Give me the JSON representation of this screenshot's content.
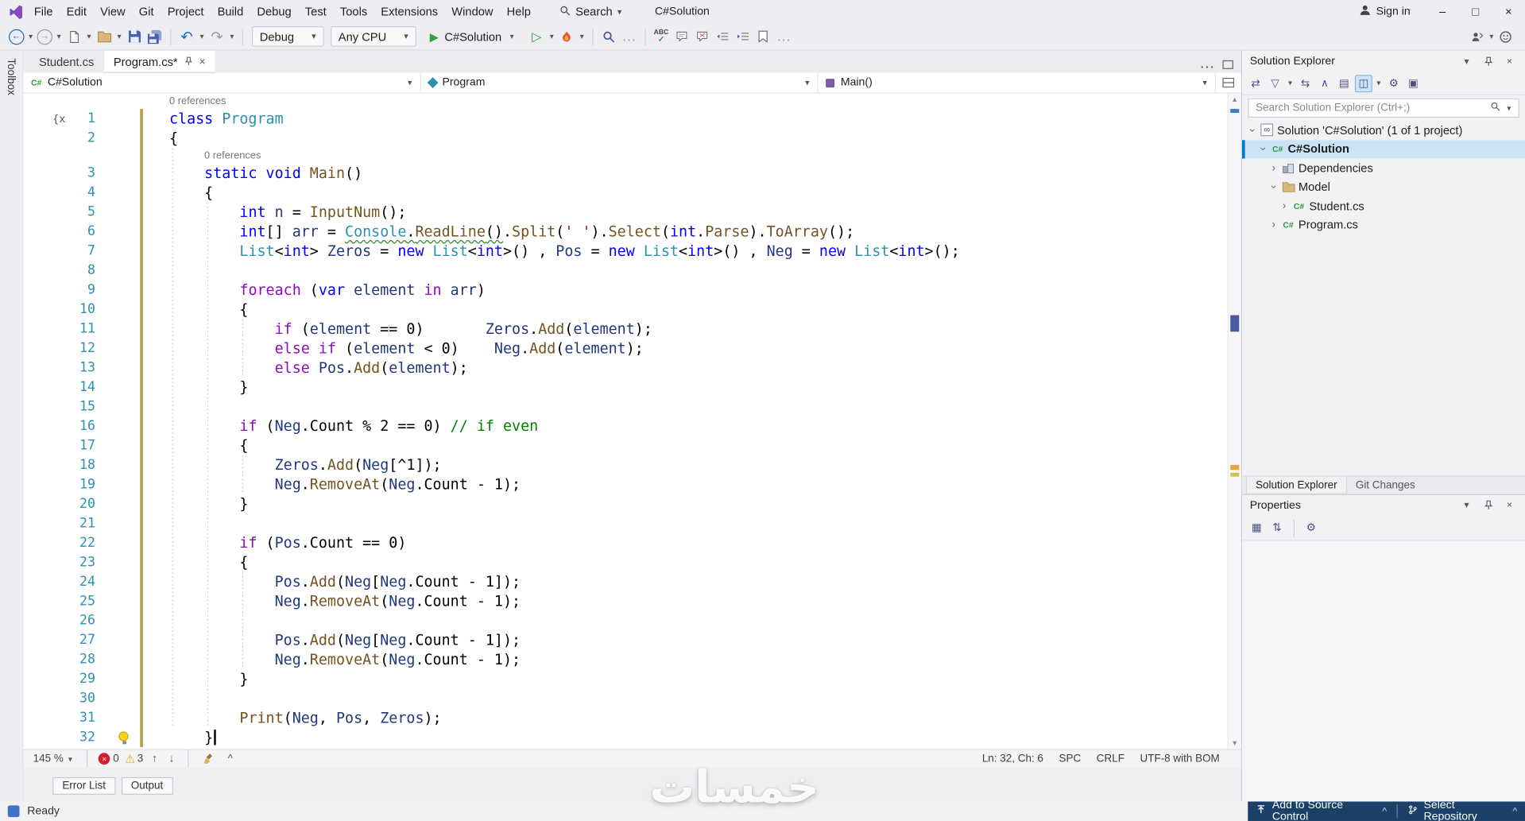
{
  "icons": {
    "back": "←",
    "forward": "→",
    "undo": "↶",
    "redo": "↷",
    "run": "▶",
    "run_outline": "▷",
    "dropdown": "▾",
    "more": "…",
    "close": "×",
    "minimize": "–",
    "maximize": "□",
    "chevron": "›",
    "collapse_all": "∧",
    "switch_views": "⇄",
    "filter": "▽",
    "sync_doc": "⇆",
    "show_all": "▤",
    "nesting": "◫",
    "preview": "▣",
    "categorized": "▦",
    "alphabetical": "⇅",
    "gear": "⚙",
    "warning": "⚠",
    "arrow_up": "↑",
    "arrow_down": "↓",
    "caret_up": "^",
    "triangle_up": "▲",
    "triangle_down": "▼",
    "infinity": "∞",
    "spell": "ABC",
    "check": "✓"
  },
  "titlebar": {
    "menu_items": [
      "File",
      "Edit",
      "View",
      "Git",
      "Project",
      "Build",
      "Debug",
      "Test",
      "Tools",
      "Extensions",
      "Window",
      "Help"
    ],
    "search_label": "Search",
    "solution_title": "C#Solution",
    "sign_in_label": "Sign in"
  },
  "toolbar": {
    "debug_target": "Debug",
    "platform": "Any CPU",
    "run_label": "C#Solution"
  },
  "toolbox_tab": "Toolbox",
  "doc_tabs": [
    {
      "label": "Student.cs",
      "active": false
    },
    {
      "label": "Program.cs*",
      "active": true
    }
  ],
  "navbar": {
    "project": "C#Solution",
    "type_name": "Program",
    "member": "Main()"
  },
  "editor": {
    "rows": [
      {
        "lens": true,
        "indent": 0,
        "text": "0 references"
      },
      {
        "n": 1,
        "glyph": true,
        "segs": [
          [
            "k",
            "class"
          ],
          [
            "p",
            " "
          ],
          [
            "t",
            "Program"
          ]
        ]
      },
      {
        "n": 2,
        "segs": [
          [
            "p",
            "{"
          ]
        ]
      },
      {
        "lens": true,
        "indent": 4,
        "text": "0 references"
      },
      {
        "n": 3,
        "segs": [
          [
            "p",
            "    "
          ],
          [
            "k",
            "static"
          ],
          [
            "p",
            " "
          ],
          [
            "k",
            "void"
          ],
          [
            "p",
            " "
          ],
          [
            "m",
            "Main"
          ],
          [
            "p",
            "()"
          ]
        ]
      },
      {
        "n": 4,
        "segs": [
          [
            "p",
            "    {"
          ]
        ]
      },
      {
        "n": 5,
        "segs": [
          [
            "p",
            "        "
          ],
          [
            "k",
            "int"
          ],
          [
            "p",
            " "
          ],
          [
            "v",
            "n"
          ],
          [
            "p",
            " = "
          ],
          [
            "m",
            "InputNum"
          ],
          [
            "p",
            "();"
          ]
        ]
      },
      {
        "n": 6,
        "segs": [
          [
            "p",
            "        "
          ],
          [
            "k",
            "int"
          ],
          [
            "p",
            "[] "
          ],
          [
            "v",
            "arr"
          ],
          [
            "p",
            " = "
          ],
          [
            "t q",
            "Console"
          ],
          [
            "p q",
            "."
          ],
          [
            "m q",
            "ReadLine"
          ],
          [
            "p q",
            "()"
          ],
          [
            "p",
            "."
          ],
          [
            "m",
            "Split"
          ],
          [
            "p",
            "("
          ],
          [
            "s",
            "' '"
          ],
          [
            "p",
            ")."
          ],
          [
            "m",
            "Select"
          ],
          [
            "p",
            "("
          ],
          [
            "k",
            "int"
          ],
          [
            "p",
            "."
          ],
          [
            "m",
            "Parse"
          ],
          [
            "p",
            ")."
          ],
          [
            "m",
            "ToArray"
          ],
          [
            "p",
            "();"
          ]
        ]
      },
      {
        "n": 7,
        "segs": [
          [
            "p",
            "        "
          ],
          [
            "t",
            "List"
          ],
          [
            "p",
            "<"
          ],
          [
            "k",
            "int"
          ],
          [
            "p",
            "> "
          ],
          [
            "v",
            "Zeros"
          ],
          [
            "p",
            " = "
          ],
          [
            "k",
            "new"
          ],
          [
            "p",
            " "
          ],
          [
            "t",
            "List"
          ],
          [
            "p",
            "<"
          ],
          [
            "k",
            "int"
          ],
          [
            "p",
            ">() , "
          ],
          [
            "v",
            "Pos"
          ],
          [
            "p",
            " = "
          ],
          [
            "k",
            "new"
          ],
          [
            "p",
            " "
          ],
          [
            "t",
            "List"
          ],
          [
            "p",
            "<"
          ],
          [
            "k",
            "int"
          ],
          [
            "p",
            ">() , "
          ],
          [
            "v",
            "Neg"
          ],
          [
            "p",
            " = "
          ],
          [
            "k",
            "new"
          ],
          [
            "p",
            " "
          ],
          [
            "t",
            "List"
          ],
          [
            "p",
            "<"
          ],
          [
            "k",
            "int"
          ],
          [
            "p",
            ">();"
          ]
        ]
      },
      {
        "n": 8,
        "segs": []
      },
      {
        "n": 9,
        "segs": [
          [
            "p",
            "        "
          ],
          [
            "c",
            "foreach"
          ],
          [
            "p",
            " ("
          ],
          [
            "k",
            "var"
          ],
          [
            "p",
            " "
          ],
          [
            "v",
            "element"
          ],
          [
            "p",
            " "
          ],
          [
            "c",
            "in"
          ],
          [
            "p",
            " "
          ],
          [
            "v",
            "arr"
          ],
          [
            "p",
            ")"
          ]
        ]
      },
      {
        "n": 10,
        "segs": [
          [
            "p",
            "        {"
          ]
        ]
      },
      {
        "n": 11,
        "segs": [
          [
            "p",
            "            "
          ],
          [
            "c",
            "if"
          ],
          [
            "p",
            " ("
          ],
          [
            "v",
            "element"
          ],
          [
            "p",
            " == 0)       "
          ],
          [
            "v",
            "Zeros"
          ],
          [
            "p",
            "."
          ],
          [
            "m",
            "Add"
          ],
          [
            "p",
            "("
          ],
          [
            "v",
            "element"
          ],
          [
            "p",
            ");"
          ]
        ]
      },
      {
        "n": 12,
        "segs": [
          [
            "p",
            "            "
          ],
          [
            "c",
            "else"
          ],
          [
            "p",
            " "
          ],
          [
            "c",
            "if"
          ],
          [
            "p",
            " ("
          ],
          [
            "v",
            "element"
          ],
          [
            "p",
            " < 0)    "
          ],
          [
            "v",
            "Neg"
          ],
          [
            "p",
            "."
          ],
          [
            "m",
            "Add"
          ],
          [
            "p",
            "("
          ],
          [
            "v",
            "element"
          ],
          [
            "p",
            ");"
          ]
        ]
      },
      {
        "n": 13,
        "segs": [
          [
            "p",
            "            "
          ],
          [
            "c",
            "else"
          ],
          [
            "p",
            " "
          ],
          [
            "v",
            "Pos"
          ],
          [
            "p",
            "."
          ],
          [
            "m",
            "Add"
          ],
          [
            "p",
            "("
          ],
          [
            "v",
            "element"
          ],
          [
            "p",
            ");"
          ]
        ]
      },
      {
        "n": 14,
        "segs": [
          [
            "p",
            "        }"
          ]
        ]
      },
      {
        "n": 15,
        "segs": []
      },
      {
        "n": 16,
        "segs": [
          [
            "p",
            "        "
          ],
          [
            "c",
            "if"
          ],
          [
            "p",
            " ("
          ],
          [
            "v",
            "Neg"
          ],
          [
            "p",
            ".Count % 2 == 0) "
          ],
          [
            "cm",
            "// if even"
          ]
        ]
      },
      {
        "n": 17,
        "segs": [
          [
            "p",
            "        {"
          ]
        ]
      },
      {
        "n": 18,
        "segs": [
          [
            "p",
            "            "
          ],
          [
            "v",
            "Zeros"
          ],
          [
            "p",
            "."
          ],
          [
            "m",
            "Add"
          ],
          [
            "p",
            "("
          ],
          [
            "v",
            "Neg"
          ],
          [
            "p",
            "[^1]);"
          ]
        ]
      },
      {
        "n": 19,
        "segs": [
          [
            "p",
            "            "
          ],
          [
            "v",
            "Neg"
          ],
          [
            "p",
            "."
          ],
          [
            "m",
            "RemoveAt"
          ],
          [
            "p",
            "("
          ],
          [
            "v",
            "Neg"
          ],
          [
            "p",
            ".Count - 1);"
          ]
        ]
      },
      {
        "n": 20,
        "segs": [
          [
            "p",
            "        }"
          ]
        ]
      },
      {
        "n": 21,
        "segs": []
      },
      {
        "n": 22,
        "segs": [
          [
            "p",
            "        "
          ],
          [
            "c",
            "if"
          ],
          [
            "p",
            " ("
          ],
          [
            "v",
            "Pos"
          ],
          [
            "p",
            ".Count == 0)"
          ]
        ]
      },
      {
        "n": 23,
        "segs": [
          [
            "p",
            "        {"
          ]
        ]
      },
      {
        "n": 24,
        "segs": [
          [
            "p",
            "            "
          ],
          [
            "v",
            "Pos"
          ],
          [
            "p",
            "."
          ],
          [
            "m",
            "Add"
          ],
          [
            "p",
            "("
          ],
          [
            "v",
            "Neg"
          ],
          [
            "p",
            "["
          ],
          [
            "v",
            "Neg"
          ],
          [
            "p",
            ".Count - 1]);"
          ]
        ]
      },
      {
        "n": 25,
        "segs": [
          [
            "p",
            "            "
          ],
          [
            "v",
            "Neg"
          ],
          [
            "p",
            "."
          ],
          [
            "m",
            "RemoveAt"
          ],
          [
            "p",
            "("
          ],
          [
            "v",
            "Neg"
          ],
          [
            "p",
            ".Count - 1);"
          ]
        ]
      },
      {
        "n": 26,
        "segs": []
      },
      {
        "n": 27,
        "segs": [
          [
            "p",
            "            "
          ],
          [
            "v",
            "Pos"
          ],
          [
            "p",
            "."
          ],
          [
            "m",
            "Add"
          ],
          [
            "p",
            "("
          ],
          [
            "v",
            "Neg"
          ],
          [
            "p",
            "["
          ],
          [
            "v",
            "Neg"
          ],
          [
            "p",
            ".Count - 1]);"
          ]
        ]
      },
      {
        "n": 28,
        "segs": [
          [
            "p",
            "            "
          ],
          [
            "v",
            "Neg"
          ],
          [
            "p",
            "."
          ],
          [
            "m",
            "RemoveAt"
          ],
          [
            "p",
            "("
          ],
          [
            "v",
            "Neg"
          ],
          [
            "p",
            ".Count - 1);"
          ]
        ]
      },
      {
        "n": 29,
        "segs": [
          [
            "p",
            "        }"
          ]
        ]
      },
      {
        "n": 30,
        "segs": []
      },
      {
        "n": 31,
        "segs": [
          [
            "p",
            "        "
          ],
          [
            "m",
            "Print"
          ],
          [
            "p",
            "("
          ],
          [
            "v",
            "Neg"
          ],
          [
            "p",
            ", "
          ],
          [
            "v",
            "Pos"
          ],
          [
            "p",
            ", "
          ],
          [
            "v",
            "Zeros"
          ],
          [
            "p",
            ");"
          ]
        ]
      },
      {
        "n": 32,
        "bulb": true,
        "segs": [
          [
            "p",
            "    }"
          ],
          [
            "caret",
            ""
          ]
        ]
      }
    ]
  },
  "editor_bar": {
    "zoom": "145 %",
    "error_count": "0",
    "warning_count": "3",
    "position": "Ln: 32, Ch: 6",
    "spaces": "SPC",
    "line_ending": "CRLF",
    "encoding": "UTF-8 with BOM"
  },
  "panel_tabs": [
    "Error List",
    "Output"
  ],
  "status_bar": {
    "ready": "Ready",
    "source_control": "Add to Source Control",
    "repository": "Select Repository"
  },
  "solution_explorer": {
    "title": "Solution Explorer",
    "search_placeholder": "Search Solution Explorer (Ctrl+;)",
    "tree": [
      {
        "label": "Solution 'C#Solution' (1 of 1 project)",
        "indent": 0,
        "chevron": "down",
        "icon": "solution"
      },
      {
        "label": "C#Solution",
        "indent": 1,
        "chevron": "down",
        "icon": "csproj",
        "selected": true,
        "bold": true
      },
      {
        "label": "Dependencies",
        "indent": 2,
        "chevron": "right",
        "icon": "deps"
      },
      {
        "label": "Model",
        "indent": 2,
        "chevron": "down",
        "icon": "folder"
      },
      {
        "label": "Student.cs",
        "indent": 3,
        "chevron": "right",
        "icon": "cs"
      },
      {
        "label": "Program.cs",
        "indent": 2,
        "chevron": "right",
        "icon": "cs"
      }
    ],
    "bottom_tabs": [
      {
        "label": "Solution Explorer",
        "active": true
      },
      {
        "label": "Git Changes",
        "active": false
      }
    ]
  },
  "properties_panel": {
    "title": "Properties"
  },
  "watermark": "خمسات",
  "colors": {
    "keyword": "#0000FF",
    "control": "#8F08C4",
    "type": "#2B91AF",
    "method": "#74531F",
    "local": "#1F377F",
    "string": "#A31515",
    "comment": "#008000",
    "line_number": "#2B91AF",
    "accent": "#0078D7",
    "status_right_bg": "#1B4169",
    "squiggle": "#2E8B2E",
    "change_bar": "#B3A14C"
  }
}
